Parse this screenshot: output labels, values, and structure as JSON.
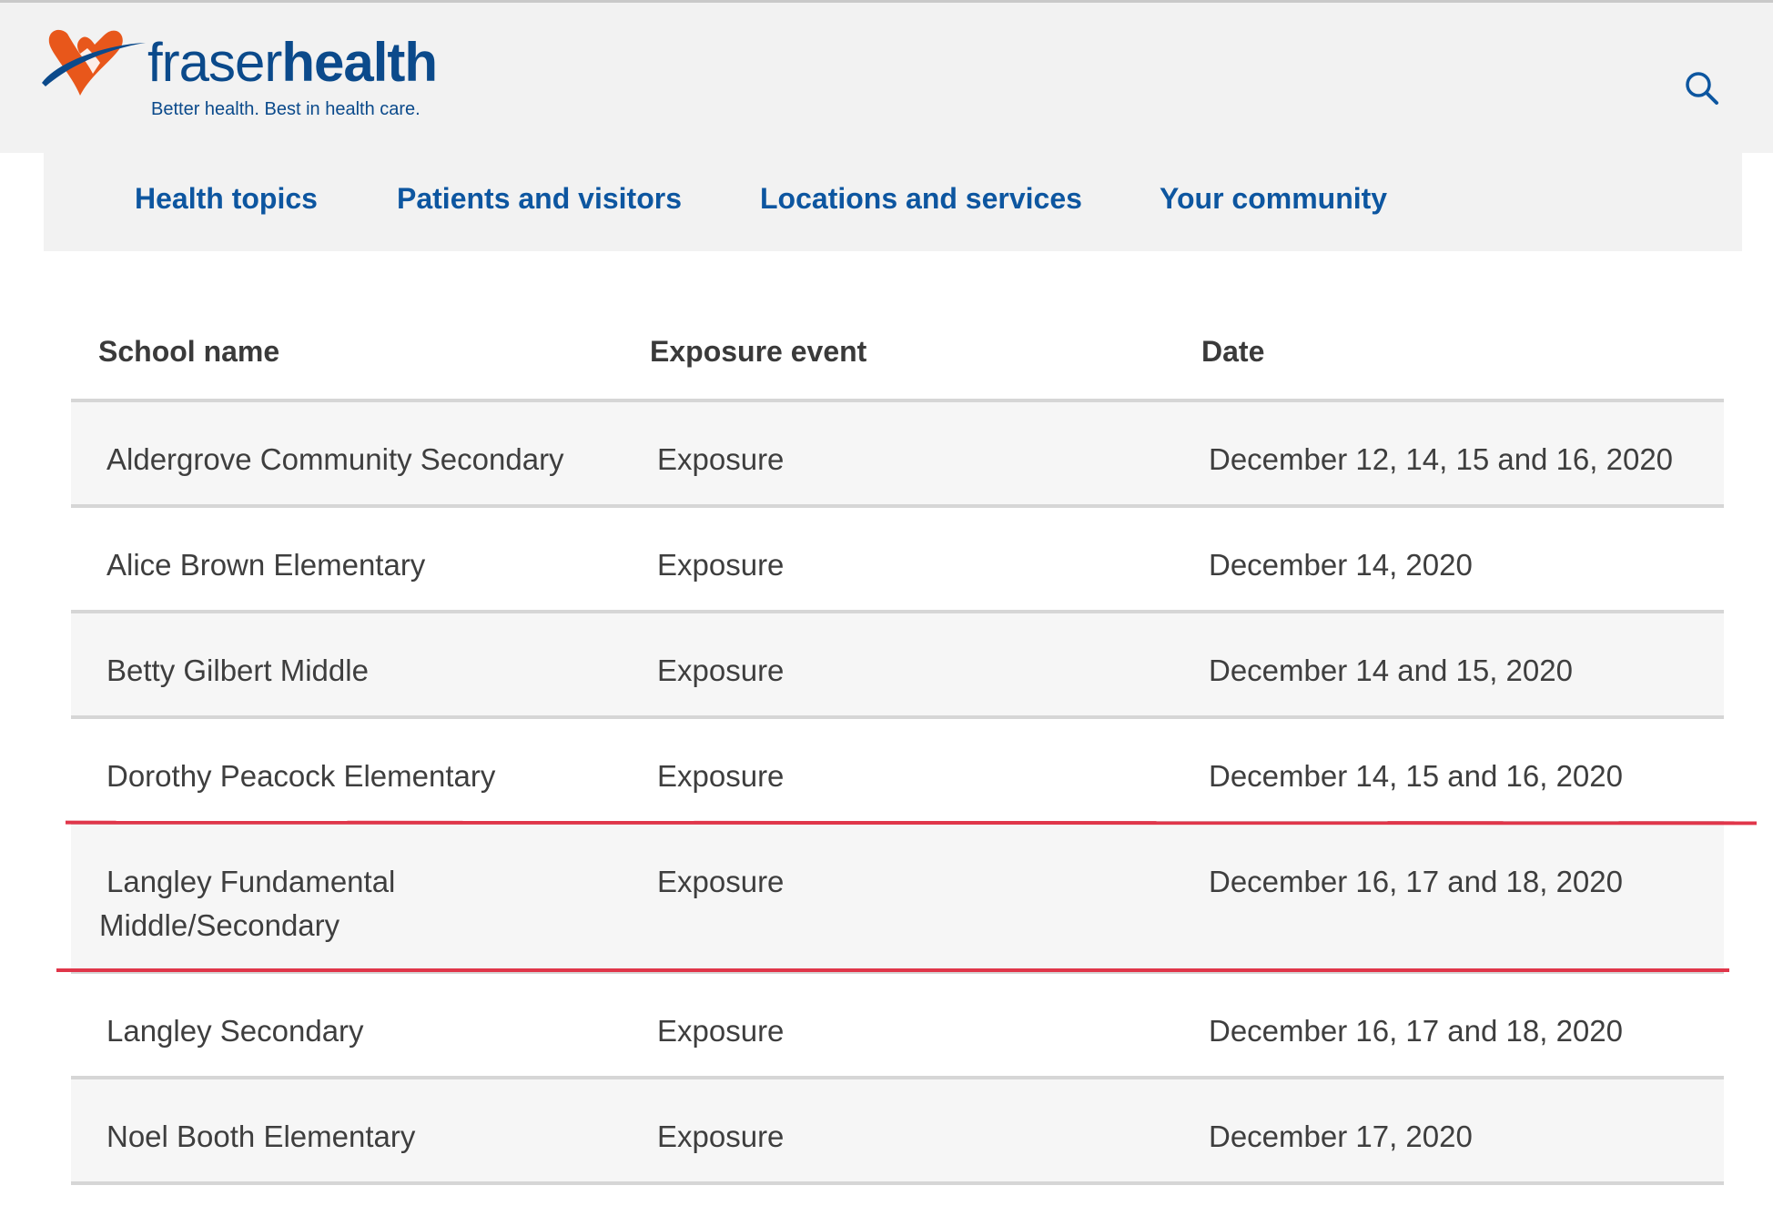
{
  "brand": {
    "name_light": "fraser",
    "name_bold": "health",
    "tagline": "Better health. Best in health care.",
    "primary_color": "#0b4a8b",
    "accent_color": "#e8571b"
  },
  "header": {
    "search_icon": "search-icon"
  },
  "nav": {
    "items": [
      {
        "label": "Health topics"
      },
      {
        "label": "Patients and visitors"
      },
      {
        "label": "Locations and services"
      },
      {
        "label": "Your community"
      }
    ]
  },
  "table": {
    "columns": [
      "School name",
      "Exposure event",
      "Date"
    ],
    "rows": [
      {
        "school": "Aldergrove Community Secondary",
        "event": "Exposure",
        "date": "December 12, 14, 15 and 16, 2020"
      },
      {
        "school": "Alice Brown Elementary",
        "event": "Exposure",
        "date": "December 14, 2020"
      },
      {
        "school": "Betty Gilbert Middle",
        "event": "Exposure",
        "date": "December 14 and 15, 2020"
      },
      {
        "school": "Dorothy Peacock Elementary",
        "event": "Exposure",
        "date": "December 14, 15 and 16, 2020"
      },
      {
        "school_line1": "Langley Fundamental",
        "school_line2": "Middle/Secondary",
        "event": "Exposure",
        "date": "December 16, 17 and 18, 2020",
        "highlighted": true
      },
      {
        "school": "Langley Secondary",
        "event": "Exposure",
        "date": "December 16, 17 and 18, 2020"
      },
      {
        "school": "Noel Booth Elementary",
        "event": "Exposure",
        "date": "December 17, 2020"
      }
    ]
  },
  "annotation": {
    "highlight_color": "#e0364a"
  }
}
